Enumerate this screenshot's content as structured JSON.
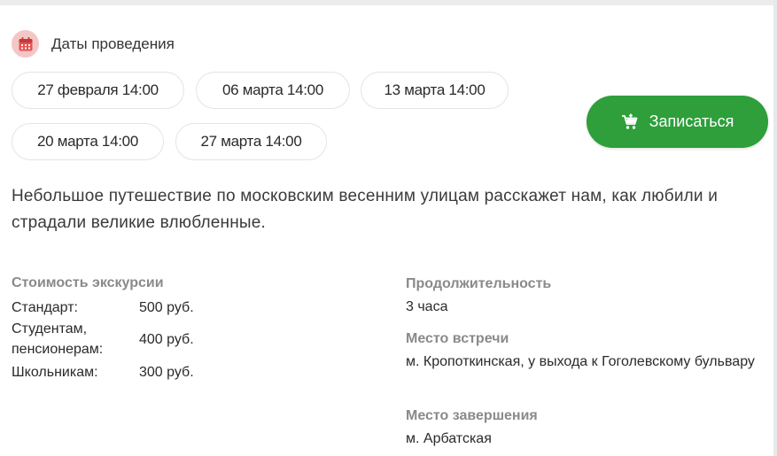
{
  "dates": {
    "header_label": "Даты проведения",
    "icon": "calendar-icon",
    "chips": [
      "27 февраля 14:00",
      "06 марта 14:00",
      "13 марта 14:00",
      "20 марта 14:00",
      "27 марта 14:00"
    ]
  },
  "signup": {
    "label": "Записаться",
    "icon": "cart-icon",
    "color": "#2e9f3a"
  },
  "description": "Небольшое путешествие по московским весенним улицам расскажет нам, как любили и страдали великие влюбленные.",
  "pricing": {
    "title": "Стоимость экскурсии",
    "rows": [
      {
        "label": "Стандарт:",
        "value": "500 руб."
      },
      {
        "label": "Студентам, пенсионерам:",
        "value": "400 руб."
      },
      {
        "label": "Школьникам:",
        "value": "300 руб."
      }
    ]
  },
  "duration": {
    "title": "Продолжительность",
    "value": "3 часа"
  },
  "meeting": {
    "title": "Место встречи",
    "value": "м. Кропоткинская, у выхода к Гоголевскому бульвару"
  },
  "end": {
    "title": "Место завершения",
    "value": "м. Арбатская"
  }
}
